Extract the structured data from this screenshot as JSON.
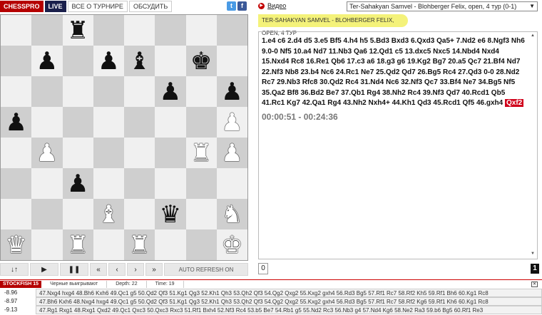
{
  "header": {
    "tabs": [
      {
        "label": "CHESSPRO"
      },
      {
        "label": "LIVE"
      },
      {
        "label": "ВСЕ О ТУРНИРЕ"
      },
      {
        "label": "ОБСУДИТЬ"
      }
    ],
    "social": {
      "twitter": "t",
      "facebook": "f"
    }
  },
  "board": {
    "light_color": "#f0f0f0",
    "dark_color": "#cfcfcf",
    "rows": [
      [
        "",
        "",
        "bR",
        "",
        "",
        "",
        "",
        ""
      ],
      [
        "",
        "bP",
        "",
        "bP",
        "bB",
        "",
        "bK",
        ""
      ],
      [
        "",
        "",
        "",
        "",
        "",
        "bP",
        "",
        "bP"
      ],
      [
        "bP",
        "",
        "",
        "",
        "",
        "",
        "",
        "wP"
      ],
      [
        "",
        "wP",
        "",
        "",
        "",
        "",
        "wR",
        "wP"
      ],
      [
        "",
        "",
        "bP",
        "",
        "",
        "",
        "",
        ""
      ],
      [
        "",
        "",
        "",
        "wB",
        "",
        "bQ",
        "",
        "wN"
      ],
      [
        "wQ",
        "",
        "wR",
        "",
        "wR",
        "",
        "",
        "wK"
      ]
    ]
  },
  "controls": {
    "flip": "↓↑",
    "play": "▶",
    "pause": "❚❚",
    "first": "«",
    "prev": "‹",
    "next": "›",
    "last": "»",
    "auto_refresh": "AUTO REFRESH ON"
  },
  "video": {
    "label": "Видео"
  },
  "game_select": {
    "value": "Ter-Sahakyan Samvel - Blohberger Felix, open, 4 тур (0-1)"
  },
  "game_title": "TER-SAHAKYAN SAMVEL - BLOHBERGER FELIX, OPEN, 4 ТУР",
  "moves": {
    "text": "1.e4 c6 2.d4 d5 3.e5 Bf5 4.h4 h5 5.Bd3 Bxd3 6.Qxd3 Qa5+ 7.Nd2 e6 8.Ngf3 Nh6 9.0-0 Nf5 10.a4 Nd7 11.Nb3 Qa6 12.Qd1 c5 13.dxc5 Nxc5 14.Nbd4 Nxd4 15.Nxd4 Rc8 16.Re1 Qb6 17.c3 a6 18.g3 g6 19.Kg2 Bg7 20.a5 Qc7 21.Bf4 Nd7 22.Nf3 Nb8 23.b4 Nc6 24.Rc1 Ne7 25.Qd2 Qd7 26.Bg5 Rc4 27.Qd3 0-0 28.Nd2 Rc7 29.Nb3 Rfc8 30.Qd2 Rc4 31.Nd4 Nc6 32.Nf3 Qc7 33.Bf4 Ne7 34.Bg5 Nf5 35.Qa2 Bf8 36.Bd2 Be7 37.Qb1 Rg4 38.Nh2 Rc4 39.Nf3 Qd7 40.Rcd1 Qb5 41.Rc1 Kg7 42.Qa1 Rg4 43.Nh2 Nxh4+ 44.Kh1 Qd3 45.Rcd1 Qf5 46.gxh4",
    "current": "Qxf2",
    "clock": "00:00:51 - 00:24:36"
  },
  "page_input": "0",
  "page_number": "1",
  "engine": {
    "name": "STOCKFISH 15",
    "status": "Черные выигрывают",
    "depth": "Depth: 22",
    "time": "Time: 19",
    "lines": [
      {
        "score": "-8.96",
        "line": "47.Nxg4 hxg4 48.Bh6 Kxh6 49.Qc1 g5 50.Qd2 Qf3 51.Kg1 Qg3 52.Kh1 Qh3 53.Qh2 Qf3 54.Qg2 Qxg2 55.Kxg2 gxh4 56.Rd3 Bg5 57.Rf1 Rc7 58.Rf2 Kh5 59.Rf1 Bh6 60.Kg1 Rc8"
      },
      {
        "score": "-8.97",
        "line": "47.Bh6 Kxh6 48.Nxg4 hxg4 49.Qc1 g5 50.Qd2 Qf3 51.Kg1 Qg3 52.Kh1 Qh3 53.Qh2 Qf3 54.Qg2 Qxg2 55.Kxg2 gxh4 56.Rd3 Bg5 57.Rf1 Rc7 58.Rf2 Kg6 59.Rf1 Kh6 60.Kg1 Rc8"
      },
      {
        "score": "-9.13",
        "line": "47.Rg1 Rxg1 48.Rxg1 Qxd2 49.Qc1 Qxc3 50.Qxc3 Rxc3 51.Rf1 Bxh4 52.Nf3 Rc4 53.b5 Be7 54.Rb1 g5 55.Nd2 Rc3 56.Nb3 g4 57.Nd4 Kg6 58.Ne2 Ra3 59.b6 Bg5 60.Rf1 Re3"
      }
    ]
  }
}
